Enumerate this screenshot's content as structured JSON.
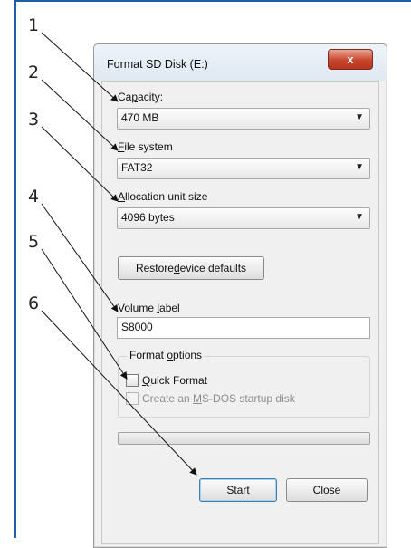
{
  "callouts": [
    "1",
    "2",
    "3",
    "4",
    "5",
    "6"
  ],
  "dialog": {
    "title": "Format SD Disk (E:)",
    "close_symbol": "x",
    "capacity": {
      "label_pre": "Ca",
      "label_key": "p",
      "label_post": "acity:",
      "value": "470 MB"
    },
    "file_system": {
      "label_key": "F",
      "label_post": "ile system",
      "value": "FAT32"
    },
    "allocation": {
      "label_key": "A",
      "label_post": "llocation unit size",
      "value": "4096 bytes"
    },
    "restore_button": {
      "pre": "Restore ",
      "key": "d",
      "post": "evice defaults"
    },
    "volume_label": {
      "label_pre": "Volume ",
      "label_key": "l",
      "label_post": "abel",
      "value": "S8000"
    },
    "format_options": {
      "title_pre": "Format ",
      "title_key": "o",
      "title_post": "ptions",
      "quick_format": {
        "key": "Q",
        "post": "uick Format",
        "checked": false
      },
      "msdos_disk": {
        "pre": "Create an ",
        "key": "M",
        "post": "S-DOS startup disk",
        "checked": false,
        "disabled": true
      }
    },
    "progress": 0,
    "start_label": "Start",
    "close_button": {
      "key": "C",
      "post": "lose"
    }
  },
  "colors": {
    "frame": "#1f5fa8",
    "close_red": "#c8462d"
  },
  "icons": {
    "close": "close-icon",
    "dropdown": "chevron-down-icon"
  }
}
